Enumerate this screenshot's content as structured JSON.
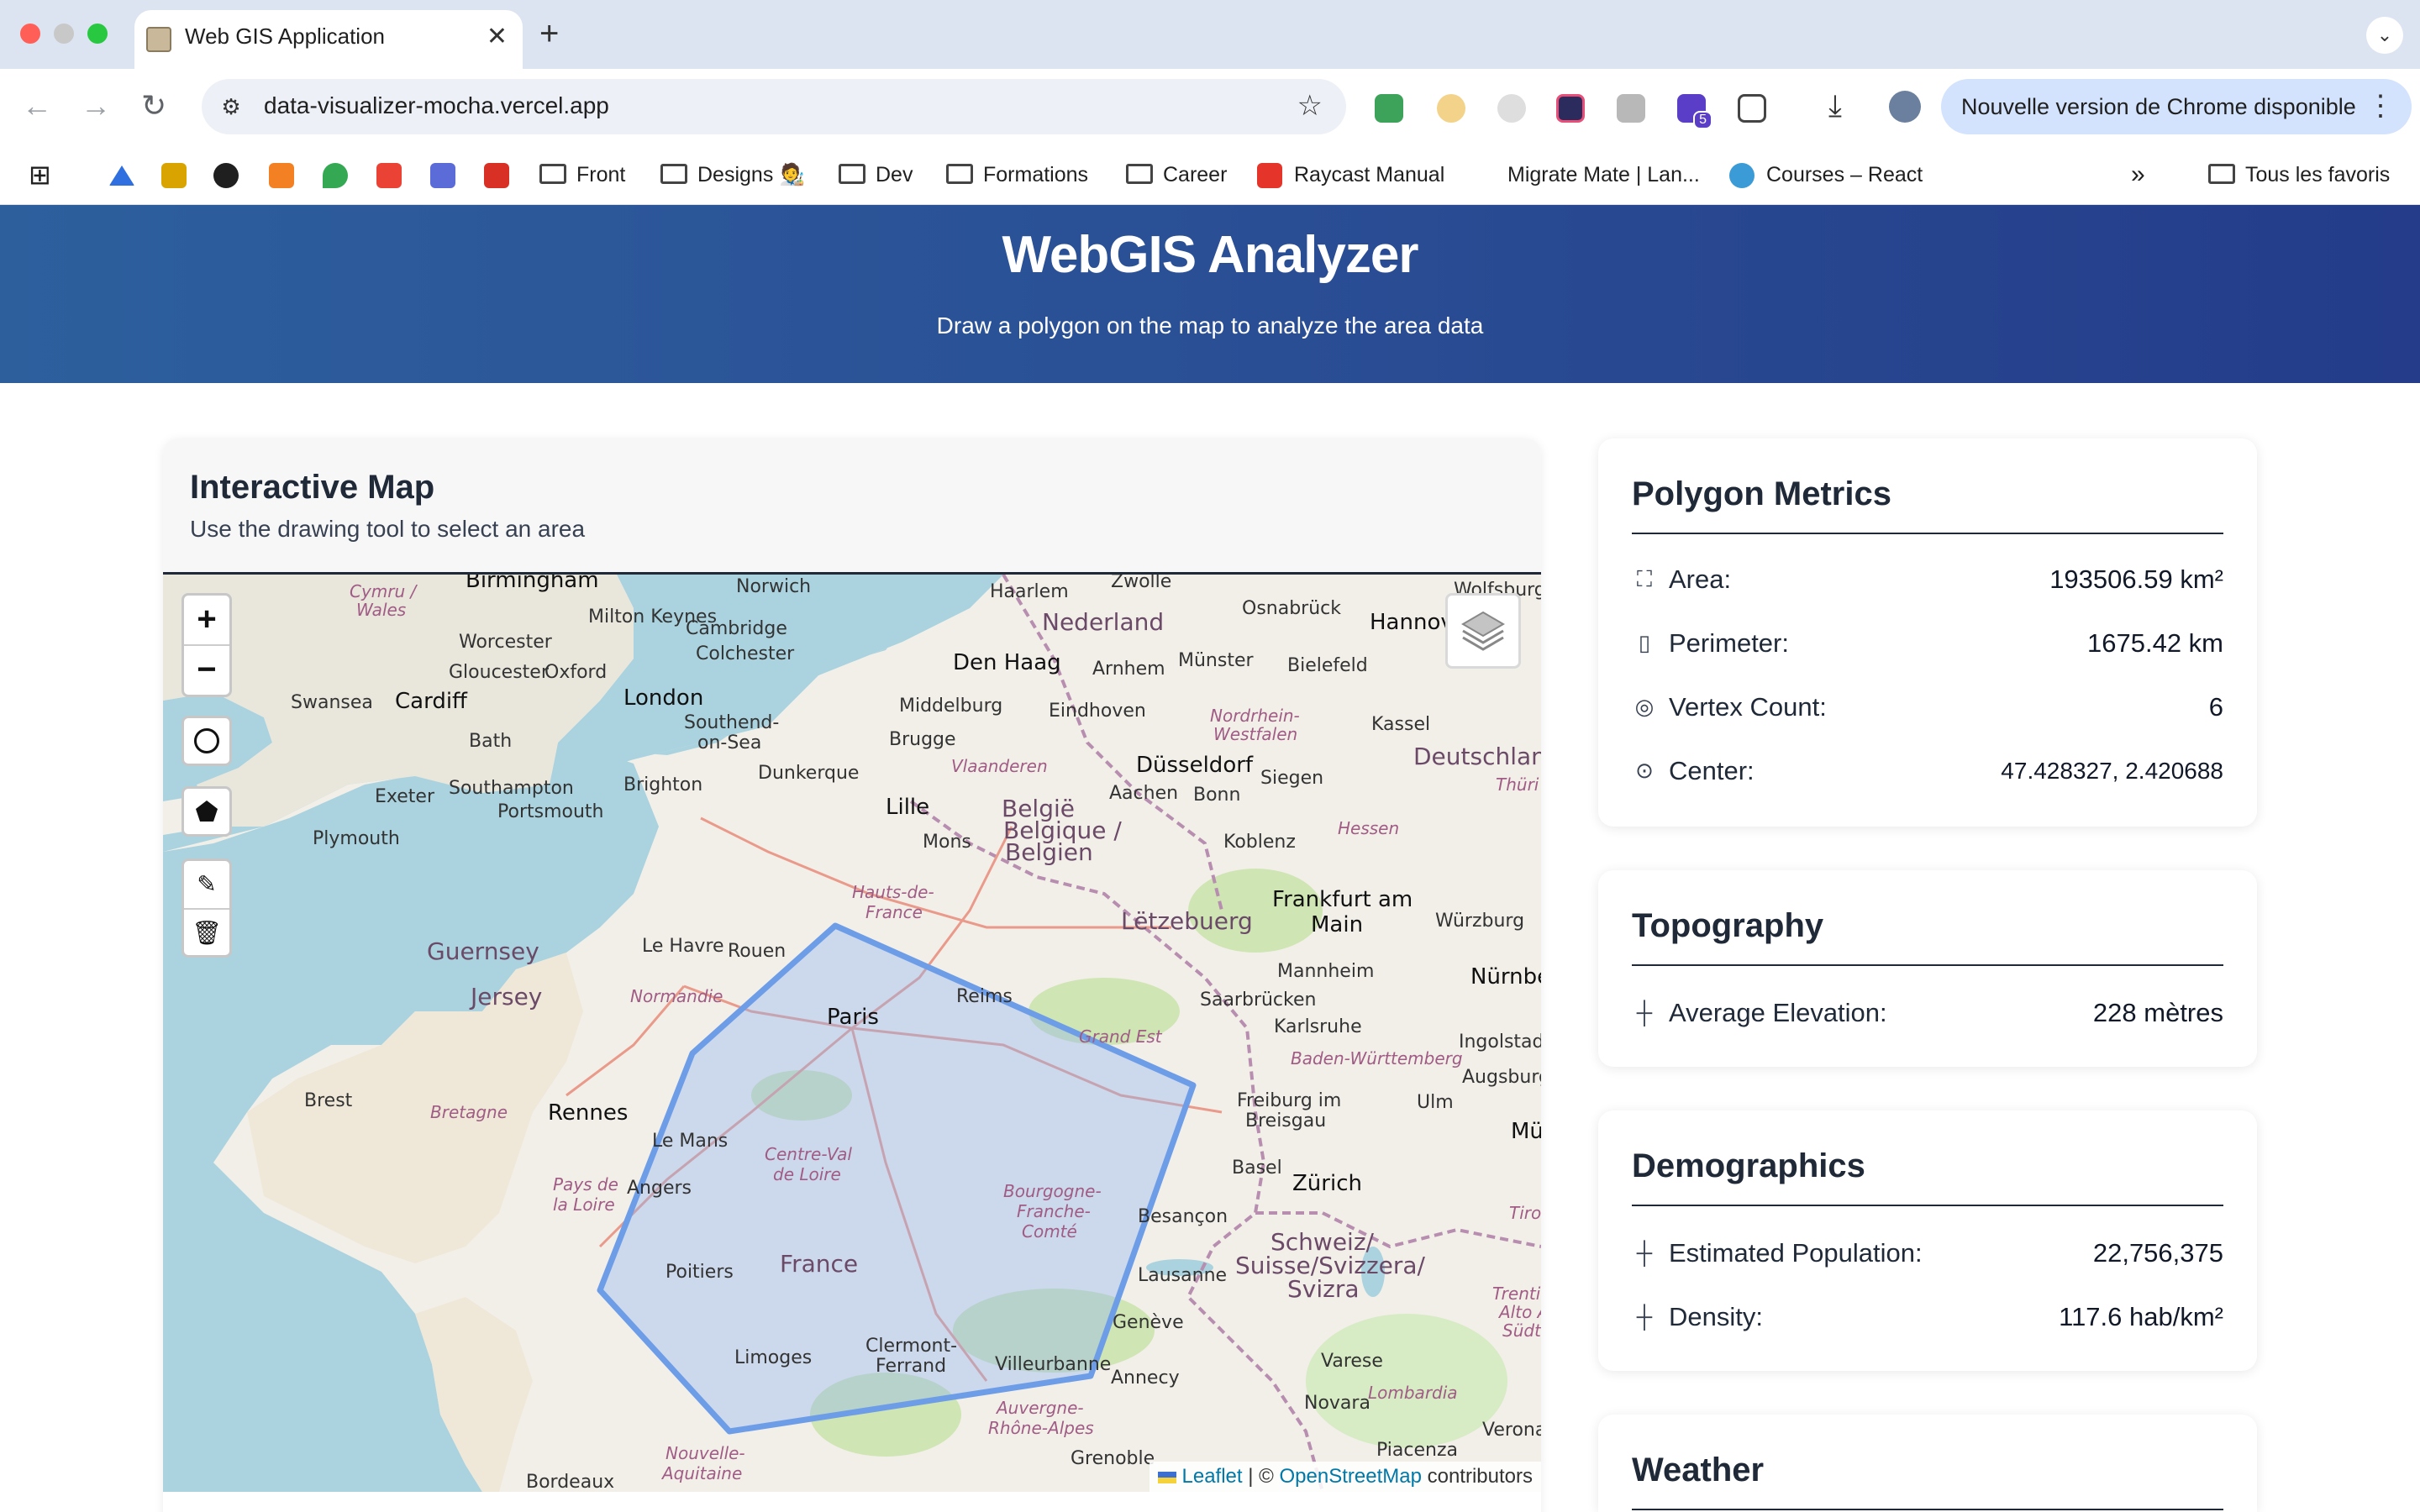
{
  "browser": {
    "tab_title": "Web GIS Application",
    "url": "data-visualizer-mocha.vercel.app",
    "update_notice": "Nouvelle version de Chrome disponible",
    "extension_badge": "5",
    "bookmarks": [
      {
        "label": "Front",
        "type": "folder"
      },
      {
        "label": "Designs 🧑‍🎨",
        "type": "folder"
      },
      {
        "label": "Dev",
        "type": "folder"
      },
      {
        "label": "Formations",
        "type": "folder"
      },
      {
        "label": "Career",
        "type": "folder"
      },
      {
        "label": "Raycast Manual",
        "type": "link"
      },
      {
        "label": "Migrate Mate | Lan...",
        "type": "link"
      },
      {
        "label": "Courses – React",
        "type": "link"
      }
    ],
    "all_bookmarks": "Tous les favoris"
  },
  "header": {
    "title": "WebGIS Analyzer",
    "subtitle": "Draw a polygon on the map to analyze the area data"
  },
  "map_card": {
    "title": "Interactive Map",
    "subtitle": "Use the drawing tool to select an area",
    "controls": {
      "zoom_in": "+",
      "zoom_out": "−"
    },
    "attribution": {
      "leaflet": "Leaflet",
      "sep": "| ©",
      "osm": "OpenStreetMap",
      "suffix": "contributors"
    },
    "labels": {
      "birmingham": "Birmingham",
      "norwich": "Norwich",
      "haarlem": "Haarlem",
      "zwolle": "Zwolle",
      "wolfsburg": "Wolfsburg",
      "cymru": "Cymru /",
      "wales": "Wales",
      "milton_keynes": "Milton Keynes",
      "cambridge": "Cambridge",
      "colchester": "Colchester",
      "nederland": "Nederland",
      "osnabruck": "Osnabrück",
      "hannover": "Hannov",
      "worcester": "Worcester",
      "oxford": "Oxford",
      "gloucester": "Gloucester",
      "den_haag": "Den Haag",
      "arnhem": "Arnhem",
      "munster": "Münster",
      "bielefeld": "Bielefeld",
      "swansea": "Swansea",
      "cardiff": "Cardiff",
      "london": "London",
      "southend": "Southend-",
      "on_sea": "on-Sea",
      "middelburg": "Middelburg",
      "eindhoven": "Eindhoven",
      "nordrhein": "Nordrhein-",
      "westfalen": "Westfalen",
      "kassel": "Kassel",
      "bath": "Bath",
      "brugge": "Brugge",
      "deutschland": "Deutschland",
      "dunkerque": "Dunkerque",
      "vlaanderen": "Vlaanderen",
      "dusseldorf": "Düsseldorf",
      "exeter": "Exeter",
      "southampton": "Southampton",
      "brighton": "Brighton",
      "siegen": "Siegen",
      "portsmouth": "Portsmouth",
      "lille": "Lille",
      "belgie": "België",
      "belgique": "Belgique /",
      "belgien": "Belgien",
      "aachen": "Aachen",
      "bonn": "Bonn",
      "thuri": "Thüri",
      "plymouth": "Plymouth",
      "mons": "Mons",
      "koblenz": "Koblenz",
      "hessen": "Hessen",
      "hauts": "Hauts-de-",
      "france_region": "France",
      "frankfurt": "Frankfurt am",
      "main": "Main",
      "letzebuerg": "Lëtzebuerg",
      "wurzburg": "Würzburg",
      "guernsey": "Guernsey",
      "le_havre": "Le Havre",
      "rouen": "Rouen",
      "mannheim": "Mannheim",
      "nurnbe": "Nürnbe",
      "jersey": "Jersey",
      "normandie": "Normandie",
      "reims": "Reims",
      "saarbrucken": "Saarbrücken",
      "paris": "Paris",
      "karlsruhe": "Karlsruhe",
      "grand_est": "Grand Est",
      "ingolstadt": "Ingolstadt",
      "baden": "Baden-Württemberg",
      "augsburg": "Augsburg",
      "brest": "Brest",
      "bretagne": "Bretagne",
      "rennes": "Rennes",
      "freiburg": "Freiburg im",
      "breisgau": "Breisgau",
      "ulm": "Ulm",
      "le_mans": "Le Mans",
      "mu": "Mü",
      "centre": "Centre-Val",
      "de_loire": "de Loire",
      "basel": "Basel",
      "zurich": "Zürich",
      "pays": "Pays de",
      "la_loire": "la Loire",
      "angers": "Angers",
      "bourgogne": "Bourgogne-",
      "franche": "Franche-",
      "comte": "Comté",
      "besancon": "Besançon",
      "tirol": "Tirol",
      "schweiz": "Schweiz/",
      "suisse": "Suisse/Svizzera/",
      "svizra": "Svizra",
      "france": "France",
      "poitiers": "Poitiers",
      "lausanne": "Lausanne",
      "trentino": "Trentin",
      "alto": "Alto A",
      "sudti": "Südti",
      "geneve": "Genève",
      "clermont": "Clermont-",
      "ferrand": "Ferrand",
      "limoges": "Limoges",
      "villeurbanne": "Villeurbanne",
      "varese": "Varese",
      "annecy": "Annecy",
      "lombardia": "Lombardia",
      "novara": "Novara",
      "auvergne": "Auvergne-",
      "rhone_alpes": "Rhône-Alpes",
      "verona": "Verona",
      "piacenza": "Piacenza",
      "nouvelle": "Nouvelle-",
      "aquitaine": "Aquitaine",
      "grenoble": "Grenoble",
      "bordeaux": "Bordeaux"
    }
  },
  "metrics": {
    "title": "Polygon Metrics",
    "area_label": "Area:",
    "area_value": "193506.59 km²",
    "perimeter_label": "Perimeter:",
    "perimeter_value": "1675.42 km",
    "vertex_label": "Vertex Count:",
    "vertex_value": "6",
    "center_label": "Center:",
    "center_value": "47.428327, 2.420688"
  },
  "topography": {
    "title": "Topography",
    "elevation_label": "Average Elevation:",
    "elevation_value": "228 mètres"
  },
  "demographics": {
    "title": "Demographics",
    "population_label": "Estimated Population:",
    "population_value": "22,756,375",
    "density_label": "Density:",
    "density_value": "117.6 hab/km²"
  },
  "weather": {
    "title": "Weather"
  },
  "colors": {
    "header_start": "#2d5f9d",
    "header_end": "#243c8a",
    "polygon_stroke": "#6e9de8",
    "polygon_fill": "#8fb4ef",
    "water": "#aad3df",
    "land": "#f2efe9"
  }
}
